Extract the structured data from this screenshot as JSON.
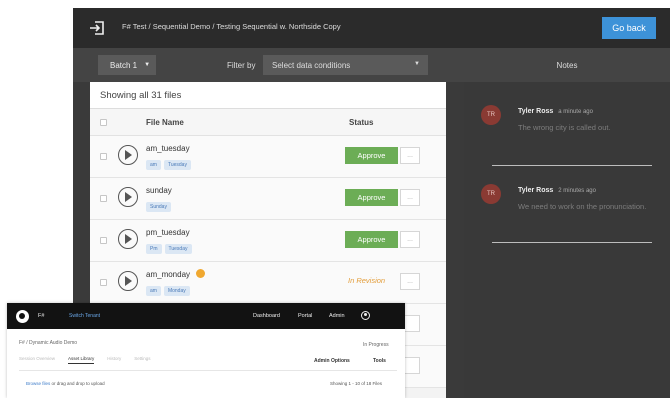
{
  "header": {
    "breadcrumb": "F# Test / Sequential Demo / Testing Sequential w. Northside Copy",
    "go_back_label": "Go back"
  },
  "toolbar": {
    "batch_label": "Batch 1",
    "filter_label": "Filter by",
    "filter_placeholder": "Select data conditions"
  },
  "files": {
    "title": "Showing all 31 files",
    "columns": {
      "name": "File Name",
      "status": "Status"
    },
    "rows": [
      {
        "name": "am_tuesday",
        "tags": [
          "am",
          "Tuesday"
        ],
        "status": "Approve",
        "more": "..."
      },
      {
        "name": "sunday",
        "tags": [
          "Sunday"
        ],
        "status": "Approve",
        "more": "..."
      },
      {
        "name": "pm_tuesday",
        "tags": [
          "Pm",
          "Tuesday"
        ],
        "status": "Approve",
        "more": "..."
      },
      {
        "name": "am_monday",
        "tags": [
          "am",
          "Monday"
        ],
        "status": "In Revision",
        "more": "..."
      }
    ]
  },
  "notes": {
    "title": "Notes",
    "items": [
      {
        "initials": "TR",
        "author": "Tyler Ross",
        "time": "a minute ago",
        "text": "The wrong city is called out."
      },
      {
        "initials": "TR",
        "author": "Tyler Ross",
        "time": "2 minutes ago",
        "text": "We need to work on the pronunciation."
      }
    ]
  },
  "overlay": {
    "brand": "F#",
    "switch_tenant": "Switch Tenant",
    "nav": [
      "Dashboard",
      "Portal",
      "Admin"
    ],
    "breadcrumb": "F# / Dynamic Audio Demo",
    "status": "In Progress",
    "tabs": [
      "Session Overview",
      "Asset Library",
      "History",
      "Settings"
    ],
    "admin_options": "Admin Options",
    "tools": "Tools",
    "browse_link": "Browse files",
    "browse_text": "or drag and drop to upload",
    "showing": "Showing 1 - 10 of 18 Files"
  },
  "colors": {
    "go_back": "#3d92d8",
    "approve": "#6cad56",
    "in_revision": "#e39d3a",
    "avatar": "#8a3a33"
  }
}
